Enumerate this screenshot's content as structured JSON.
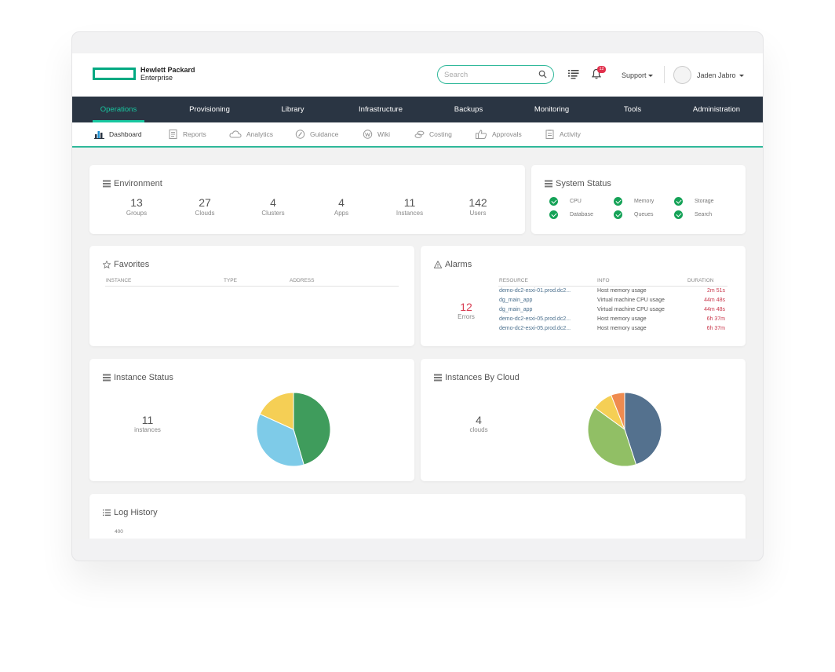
{
  "header": {
    "logo_line1": "Hewlett Packard",
    "logo_line2": "Enterprise",
    "search_placeholder": "Search",
    "notification_count": "12",
    "support_label": "Support",
    "user_name": "Jaden Jabro",
    "brand_color": "#01a982"
  },
  "main_nav": {
    "items": [
      "Operations",
      "Provisioning",
      "Library",
      "Infrastructure",
      "Backups",
      "Monitoring",
      "Tools",
      "Administration"
    ],
    "active": "Operations"
  },
  "sub_nav": {
    "items": [
      {
        "label": "Dashboard",
        "icon": "bar-chart-icon"
      },
      {
        "label": "Reports",
        "icon": "document-icon"
      },
      {
        "label": "Analytics",
        "icon": "cloud-icon"
      },
      {
        "label": "Guidance",
        "icon": "compass-icon"
      },
      {
        "label": "Wiki",
        "icon": "wiki-icon"
      },
      {
        "label": "Costing",
        "icon": "coins-icon"
      },
      {
        "label": "Approvals",
        "icon": "thumbs-up-icon"
      },
      {
        "label": "Activity",
        "icon": "clipboard-icon"
      }
    ],
    "active": "Dashboard"
  },
  "environment": {
    "title": "Environment",
    "stats": [
      {
        "value": "13",
        "label": "Groups"
      },
      {
        "value": "27",
        "label": "Clouds"
      },
      {
        "value": "4",
        "label": "Clusters"
      },
      {
        "value": "4",
        "label": "Apps"
      },
      {
        "value": "11",
        "label": "Instances"
      },
      {
        "value": "142",
        "label": "Users"
      }
    ]
  },
  "system_status": {
    "title": "System Status",
    "items": [
      "CPU",
      "Memory",
      "Storage",
      "Database",
      "Queues",
      "Search"
    ],
    "ok_color": "#15a257"
  },
  "favorites": {
    "title": "Favorites",
    "columns": [
      "INSTANCE",
      "TYPE",
      "ADDRESS"
    ]
  },
  "alarms": {
    "title": "Alarms",
    "count": "12",
    "count_label": "Errors",
    "columns": [
      "RESOURCE",
      "INFO",
      "DURATION"
    ],
    "rows": [
      {
        "resource": "demo-dc2-esxi-01.prod.dc2...",
        "info": "Host memory usage",
        "duration": "2m 51s"
      },
      {
        "resource": "dg_main_app",
        "info": "Virtual machine CPU usage",
        "duration": "44m 48s"
      },
      {
        "resource": "dg_main_app",
        "info": "Virtual machine CPU usage",
        "duration": "44m 48s"
      },
      {
        "resource": "demo-dc2-esxi-05.prod.dc2...",
        "info": "Host memory usage",
        "duration": "6h 37m"
      },
      {
        "resource": "demo-dc2-esxi-05.prod.dc2...",
        "info": "Host memory usage",
        "duration": "6h 37m"
      }
    ]
  },
  "instance_status": {
    "title": "Instance Status",
    "count": "11",
    "count_label": "instances",
    "chart_data": {
      "type": "pie",
      "values": [
        5,
        4,
        2
      ],
      "colors": [
        "#3f9c5c",
        "#7ecbe8",
        "#f5cf55"
      ]
    }
  },
  "instances_by_cloud": {
    "title": "Instances By Cloud",
    "count": "4",
    "count_label": "clouds",
    "chart_data": {
      "type": "pie",
      "values": [
        4.5,
        4.0,
        0.9,
        0.6
      ],
      "colors": [
        "#54718e",
        "#91bf65",
        "#f5cf55",
        "#ef8b4f"
      ]
    }
  },
  "log_history": {
    "title": "Log History",
    "y_tick": "400"
  }
}
